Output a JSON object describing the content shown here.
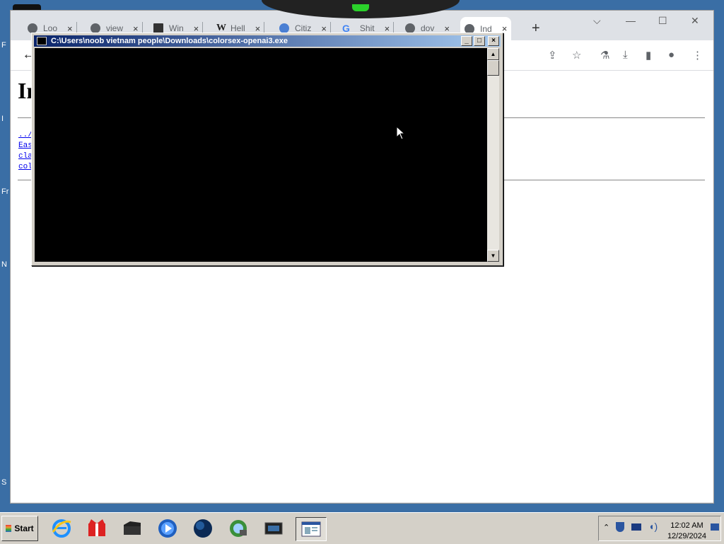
{
  "desktop": {
    "fragments": [
      "F",
      "I",
      "Fr",
      "N",
      "S"
    ]
  },
  "browser": {
    "tabs": [
      {
        "label": "Loo",
        "icon": "globe-icon"
      },
      {
        "label": "view",
        "icon": "globe-icon"
      },
      {
        "label": "Win",
        "icon": "library-icon"
      },
      {
        "label": "Hell",
        "icon": "wikipedia-icon"
      },
      {
        "label": "Citiz",
        "icon": "search-icon"
      },
      {
        "label": "Shit",
        "icon": "google-icon"
      },
      {
        "label": "dov",
        "icon": "globe-icon"
      },
      {
        "label": "Ind",
        "icon": "globe-icon",
        "active": true
      }
    ],
    "new_tab": "+",
    "page": {
      "heading": "In",
      "links": [
        "../",
        "Eas",
        "cla",
        "col"
      ]
    }
  },
  "console": {
    "title": "C:\\Users\\noob vietnam people\\Downloads\\colorsex-openai3.exe",
    "buttons": {
      "minimize": "_",
      "maximize": "□",
      "close": "×"
    }
  },
  "taskbar": {
    "start_label": "Start",
    "apps": [
      "internet-explorer-icon",
      "gift-icon",
      "folder-icon",
      "media-player-icon",
      "globe-icon",
      "network-icon",
      "monitor-icon",
      "console-app-icon"
    ],
    "clock": {
      "time": "12:02 AM",
      "date": "12/29/2024"
    }
  }
}
